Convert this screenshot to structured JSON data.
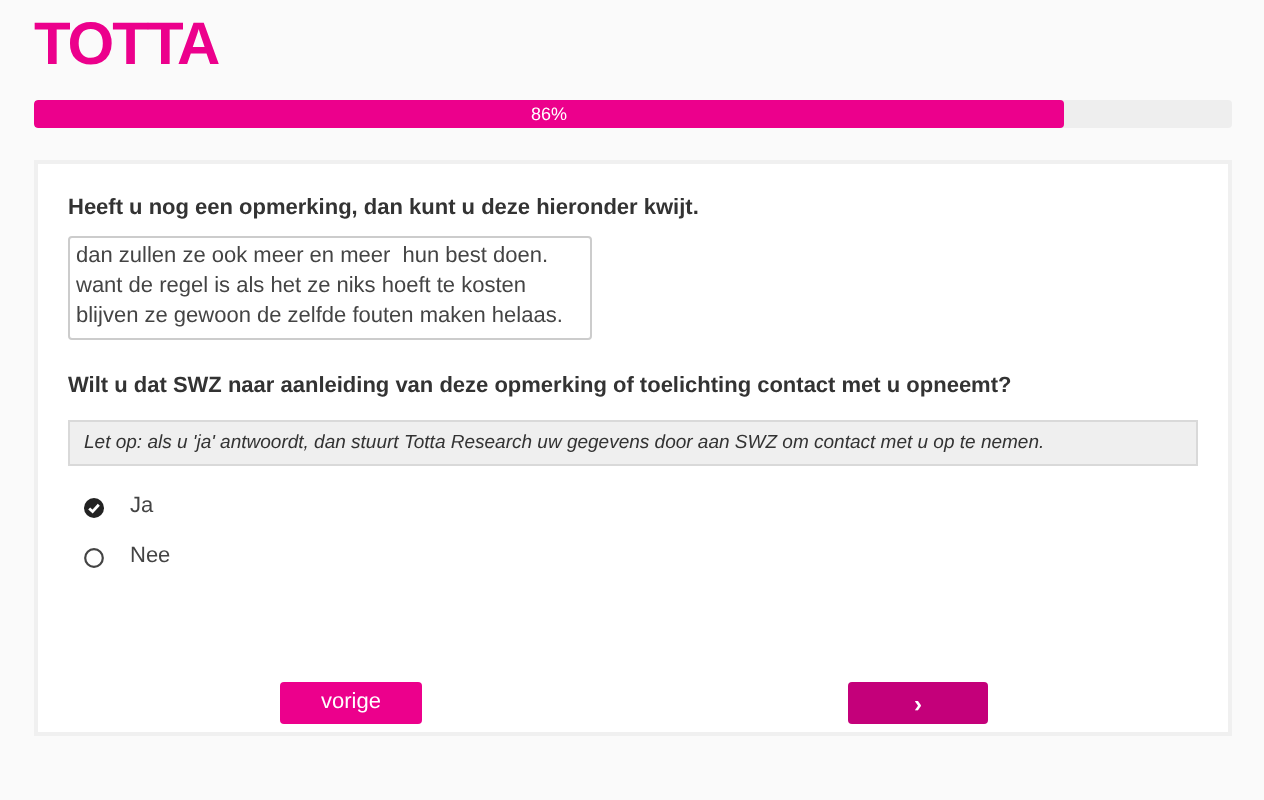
{
  "logo": {
    "text": "TOTTA"
  },
  "progress": {
    "level": 0.86,
    "label": "86%"
  },
  "question_1": {
    "label": "Heeft u nog een opmerking, dan kunt u deze hieronder kwijt.",
    "value": "dan zullen ze ook meer en meer  hun best doen.\nwant de regel is als het ze niks hoeft te kosten\nblijven ze gewoon de zelfde fouten maken helaas."
  },
  "question_2": {
    "label": "Wilt u dat SWZ naar aanleiding van deze opmerking of toelichting contact met u opneemt?",
    "note": "Let op: als u 'ja' antwoordt, dan stuurt Totta Research uw gegevens door aan SWZ om contact met u op te nemen.",
    "options": [
      {
        "label": "Ja",
        "selected": true
      },
      {
        "label": "Nee",
        "selected": false
      }
    ]
  },
  "buttons": {
    "previous": "vorige",
    "next": "›"
  }
}
